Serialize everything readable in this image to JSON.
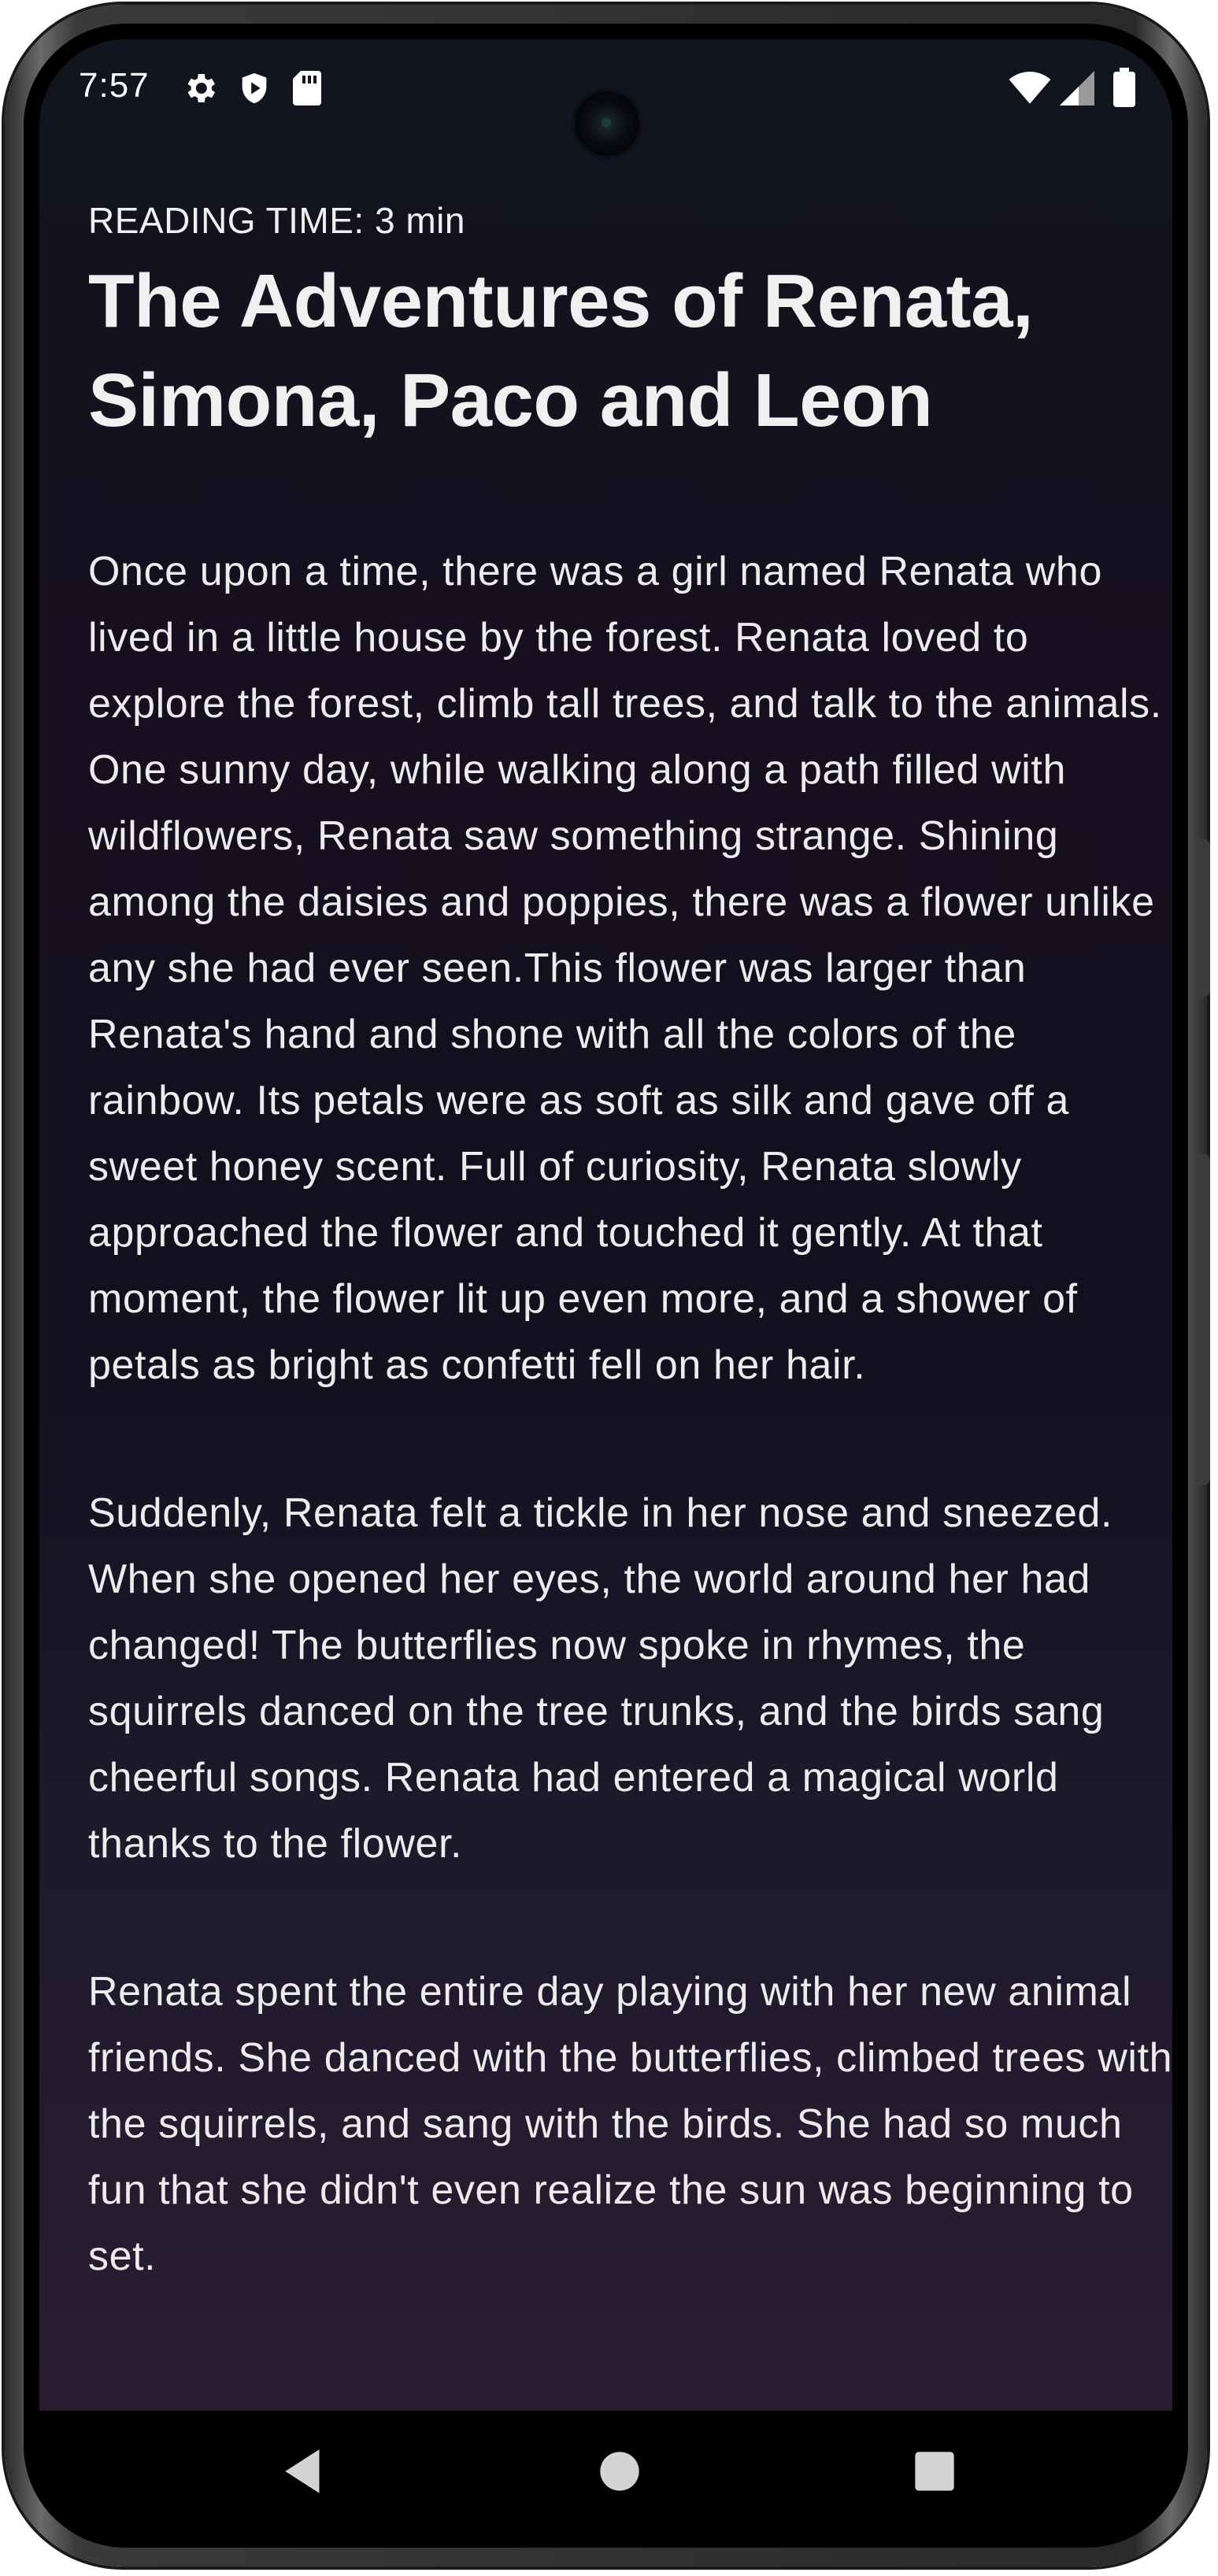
{
  "status_bar": {
    "time": "7:57",
    "left_icons": [
      "settings-icon",
      "shield-icon",
      "sd-card-icon"
    ],
    "right_icons": [
      "wifi-icon",
      "cellular-signal-icon",
      "battery-icon"
    ]
  },
  "story": {
    "reading_time": "READING TIME: 3 min",
    "title": "The Adventures of Renata, Simona, Paco and Leon",
    "paragraphs": [
      "Once upon a time, there was a girl named Renata who lived in a little house by the forest. Renata loved to explore the forest, climb tall trees, and talk to the animals. One sunny day, while walking along a path filled with wildflowers, Renata saw something strange. Shining among the daisies and poppies, there was a flower unlike any she had ever seen.This flower was larger than Renata's hand and shone with all the colors of the rainbow. Its petals were as soft as silk and gave off a sweet honey scent. Full of curiosity, Renata slowly approached the flower and touched it gently. At that moment, the flower lit up even more, and a shower of petals as bright as confetti fell on her hair.",
      "Suddenly, Renata felt a tickle in her nose and sneezed. When she opened her eyes, the world around her had changed! The butterflies now spoke in rhymes, the squirrels danced on the tree trunks, and the birds sang cheerful songs. Renata had entered a magical world thanks to the flower.",
      "Renata spent the entire day playing with her new animal friends. She danced with the butterflies, climbed trees with the squirrels, and sang with the birds. She had so much fun that she didn't even realize the sun was beginning to set."
    ]
  },
  "nav_bar": {
    "buttons": [
      "back-icon",
      "home-icon",
      "recents-icon"
    ]
  },
  "colors": {
    "background_top": "#11151f",
    "background_bottom": "#2d1e34",
    "text": "#f0f0f0",
    "nav_bar": "#000000"
  }
}
